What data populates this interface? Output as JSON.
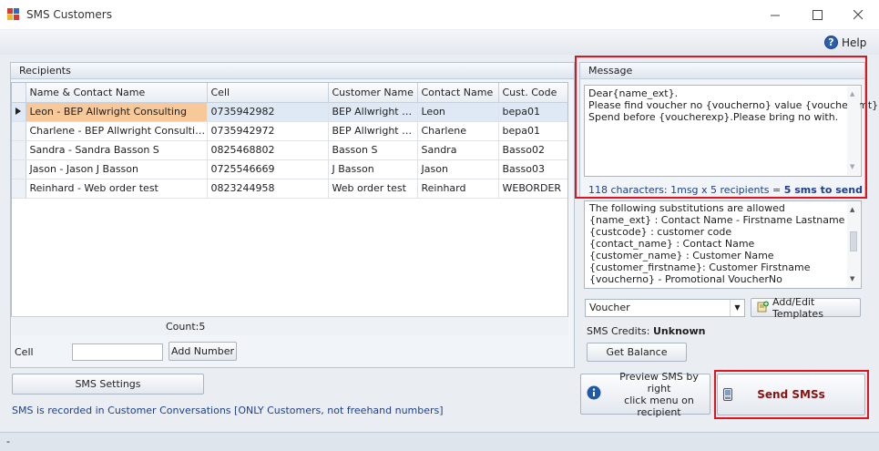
{
  "window": {
    "title": "SMS Customers"
  },
  "help": {
    "label": "Help"
  },
  "recipients": {
    "title": "Recipients",
    "columns": [
      "Name  & Contact Name",
      "Cell",
      "Customer Name",
      "Contact Name",
      "Cust. Code"
    ],
    "rows": [
      [
        "Leon - BEP Allwright Consulting",
        "0735942982",
        "BEP Allwright Co...",
        "Leon",
        "bepa01"
      ],
      [
        "Charlene - BEP Allwright Consulting",
        "0735942972",
        "BEP Allwright Co...",
        "Charlene",
        "bepa01"
      ],
      [
        "Sandra - Sandra Basson S",
        "0825468802",
        "Basson S",
        "Sandra",
        "Basso02"
      ],
      [
        "Jason - Jason J Basson",
        "0725546669",
        "J Basson",
        "Jason",
        "Basso03"
      ],
      [
        "Reinhard - Web order test",
        "0823244958",
        "Web order test",
        "Reinhard",
        "WEBORDER"
      ]
    ],
    "count_label": "Count:5",
    "cell_label": "Cell",
    "cell_value": "",
    "add_number_label": "Add Number"
  },
  "sms_settings_label": "SMS Settings",
  "recorded_note": "SMS is recorded in Customer Conversations [ONLY Customers, not freehand numbers]",
  "message": {
    "title": "Message",
    "lines": [
      "Dear{name_ext}.",
      "Please find voucher no {voucherno} value {voucheramt}",
      "Spend before {voucherexp}.Please bring no with."
    ],
    "stats_prefix": "118 characters: 1msg x 5 recipients = ",
    "stats_bold": "5 sms to send"
  },
  "substitutions": [
    "The following substitutions are allowed",
    "{name_ext} : Contact Name - Firstname Lastname",
    "{custcode} : customer code",
    "{contact_name} : Contact Name",
    "{customer_name} : Customer Name",
    "{customer_firstname}: Customer Firstname",
    "{voucherno} - Promotional VoucherNo"
  ],
  "template": {
    "selected": "Voucher",
    "edit_label": "Add/Edit Templates"
  },
  "credits": {
    "label": "SMS Credits:",
    "value": "Unknown",
    "get_balance_label": "Get Balance"
  },
  "preview": {
    "line1": "Preview SMS by right",
    "line2": "click menu on recipient"
  },
  "send": {
    "label": "Send SMSs"
  },
  "status": {
    "text": "-"
  },
  "colors": {
    "highlight": "#e0141e",
    "selected_cell": "#f7c89a",
    "send_text": "#8b1010",
    "info_icon": "#1f5aa8"
  }
}
